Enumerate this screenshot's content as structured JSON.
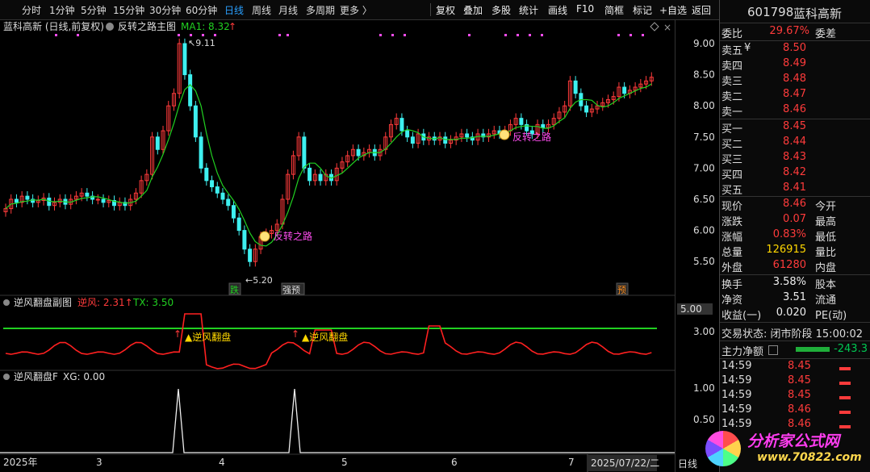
{
  "toolbar": {
    "periods": [
      "分时",
      "1分钟",
      "5分钟",
      "15分钟",
      "30分钟",
      "60分钟",
      "日线",
      "周线",
      "月线",
      "多周期",
      "更多 〉"
    ],
    "actions": [
      "复权",
      "叠加",
      "多股",
      "统计",
      "画线",
      "F10",
      "简框",
      "标记",
      "+自选",
      "返回"
    ]
  },
  "main_chart": {
    "title": "蓝科高新 (日线,前复权)",
    "indicator": "反转之路主图",
    "ma_label": "MA1: 8.32",
    "ma_arrow": "↑",
    "high_label": "9.11",
    "low_label": "5.20",
    "signal_label_1": "反转之路",
    "signal_label_2": "反转之路",
    "badge_1": "跌",
    "badge_2": "强预",
    "badge_3": "预",
    "y_ticks": [
      "9.00",
      "8.50",
      "8.00",
      "7.50",
      "7.00",
      "6.50",
      "6.00",
      "5.50"
    ]
  },
  "sub_chart_1": {
    "title": "逆风翻盘副图",
    "nifeng_label": "逆风:",
    "nifeng_value": "2.31",
    "nifeng_arrow": "↑",
    "tx_label": "TX: 3.50",
    "signal_1": "▲逆风翻盘",
    "signal_2": "▲逆风翻盘",
    "y_ticks": [
      "5.00",
      "3.00"
    ]
  },
  "sub_chart_2": {
    "title": "逆风翻盘F",
    "xg_label": "XG: 0.00",
    "y_ticks": [
      "1.00",
      "0.50"
    ]
  },
  "x_axis": {
    "labels": [
      "2025年",
      "3",
      "4",
      "5",
      "6",
      "7",
      "2025/07/22/二"
    ],
    "corner": "日线"
  },
  "quote_panel": {
    "code": "601798",
    "name": "蓝科高新",
    "webi_label": "委比",
    "webi_value": "29.67%",
    "weicha_label": "委差",
    "asks": [
      {
        "label": "卖五",
        "yen": "¥",
        "price": "8.50"
      },
      {
        "label": "卖四",
        "price": "8.49"
      },
      {
        "label": "卖三",
        "price": "8.48"
      },
      {
        "label": "卖二",
        "price": "8.47"
      },
      {
        "label": "卖一",
        "price": "8.46"
      }
    ],
    "bids": [
      {
        "label": "买一",
        "price": "8.45"
      },
      {
        "label": "买二",
        "price": "8.44"
      },
      {
        "label": "买三",
        "price": "8.43"
      },
      {
        "label": "买四",
        "price": "8.42"
      },
      {
        "label": "买五",
        "price": "8.41"
      }
    ],
    "stats": [
      {
        "label": "现价",
        "value": "8.46",
        "label2": "今开"
      },
      {
        "label": "涨跌",
        "value": "0.07",
        "label2": "最高"
      },
      {
        "label": "涨幅",
        "value": "0.83%",
        "label2": "最低"
      },
      {
        "label": "总量",
        "value": "126915",
        "label2": "量比"
      },
      {
        "label": "外盘",
        "value": "61280",
        "label2": "内盘"
      }
    ],
    "stats2": [
      {
        "label": "换手",
        "value": "3.58%",
        "label2": "股本"
      },
      {
        "label": "净资",
        "value": "3.51",
        "label2": "流通"
      },
      {
        "label": "收益(一)",
        "value": "0.020",
        "label2": "PE(动)"
      }
    ],
    "trade_status": "交易状态: 闭市阶段 15:00:02",
    "net_flow_label": "主力净额",
    "net_flow_value": "-243.3",
    "ticks": [
      {
        "time": "14:59",
        "price": "8.45"
      },
      {
        "time": "14:59",
        "price": "8.45"
      },
      {
        "time": "14:59",
        "price": "8.45"
      },
      {
        "time": "14:59",
        "price": "8.46"
      },
      {
        "time": "14:59",
        "price": "8.46"
      }
    ]
  },
  "watermark": {
    "line1": "分析家公式网",
    "line2": "www.70822.com"
  }
}
